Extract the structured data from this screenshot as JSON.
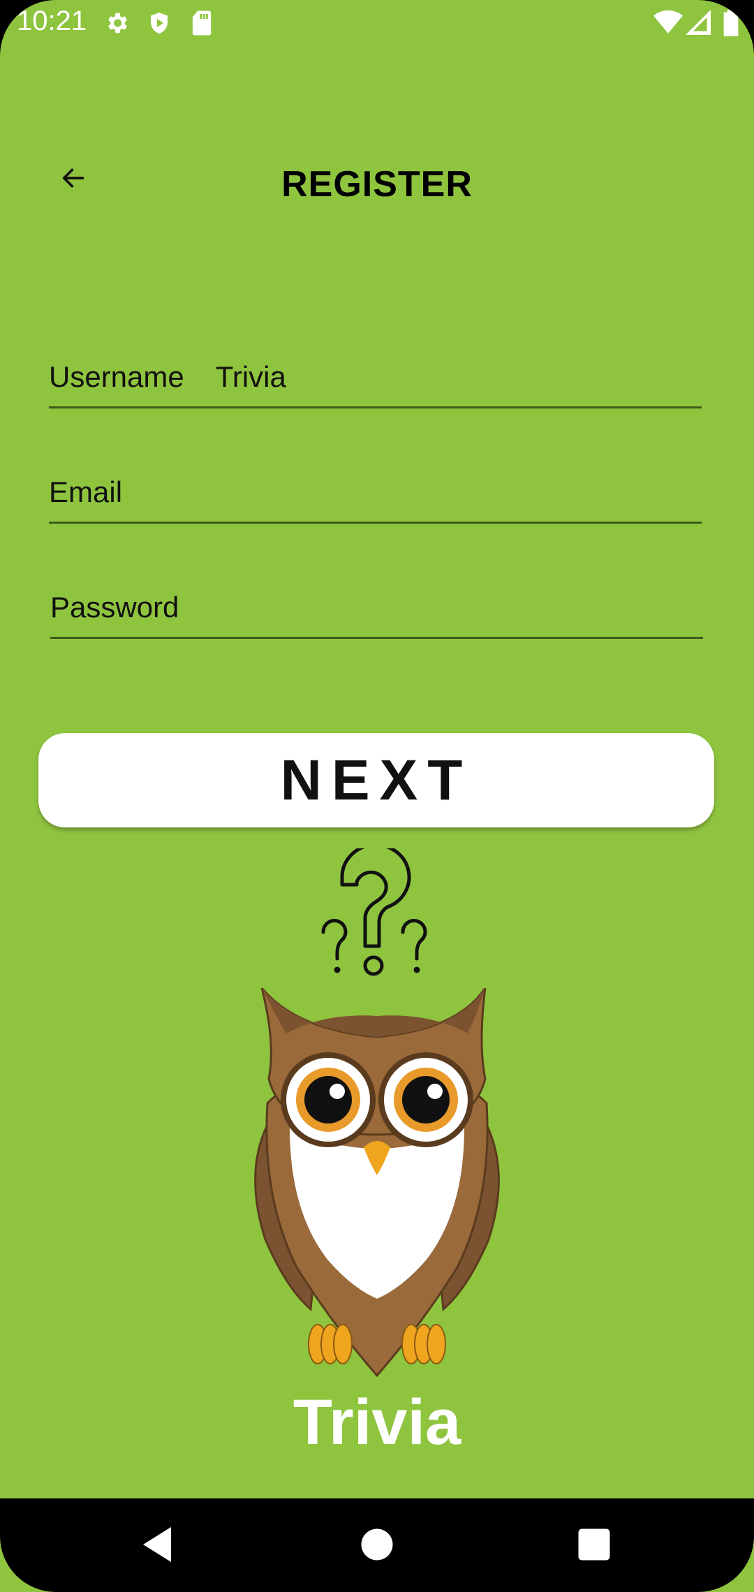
{
  "status_bar": {
    "time": "10:21",
    "icons": [
      "gear-icon",
      "shield-icon",
      "sd-card-icon",
      "wifi-icon",
      "signal-icon",
      "battery-icon"
    ]
  },
  "header": {
    "back_icon": "arrow-left-icon",
    "title": "REGISTER"
  },
  "form": {
    "username": {
      "label": "Username",
      "value": "Trivia"
    },
    "email": {
      "label": "Email",
      "value": ""
    },
    "password": {
      "label": "Password",
      "value": ""
    }
  },
  "next_button": {
    "label": "NEXT"
  },
  "illustration": {
    "question_marks": "question-marks-icon",
    "owl": "owl-illustration"
  },
  "app_name": "Trivia",
  "nav_bar": {
    "icons": [
      "back-triangle-icon",
      "home-circle-icon",
      "recents-square-icon"
    ]
  },
  "colors": {
    "background": "#8fc43f",
    "button": "#ffffff",
    "text": "#111111",
    "owl_brown": "#9a6a3a",
    "owl_eye": "#e89a2a"
  }
}
